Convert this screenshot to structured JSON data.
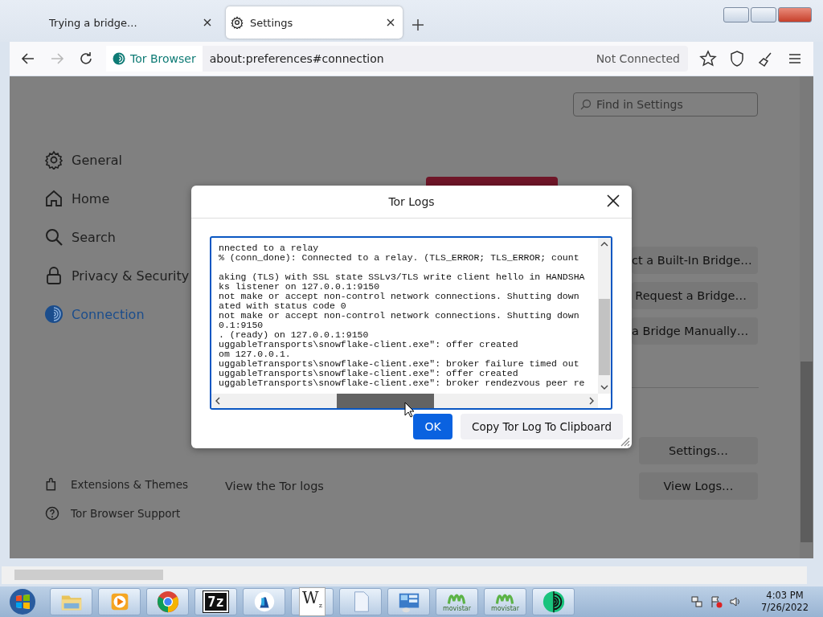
{
  "tabs": [
    {
      "title": "Trying a bridge...",
      "selected": false
    },
    {
      "title": "Settings",
      "selected": true
    }
  ],
  "toolbar": {
    "identity": "Tor Browser",
    "url": "about:preferences#connection",
    "status": "Not Connected",
    "forward_disabled": true
  },
  "search": {
    "placeholder": "Find in Settings"
  },
  "sidebar": {
    "items": [
      {
        "label": "General",
        "kind": "gear",
        "selected": false
      },
      {
        "label": "Home",
        "kind": "home",
        "selected": false
      },
      {
        "label": "Search",
        "kind": "search",
        "selected": false
      },
      {
        "label": "Privacy & Security",
        "kind": "lock",
        "selected": false
      },
      {
        "label": "Connection",
        "kind": "onion",
        "selected": true
      }
    ],
    "footer": [
      {
        "label": "Extensions & Themes",
        "kind": "puzzle"
      },
      {
        "label": "Tor Browser Support",
        "kind": "help"
      }
    ]
  },
  "bridges": {
    "buttons": [
      "ct a Built-In Bridge…",
      "Request a Bridge…",
      "a Bridge Manually…"
    ]
  },
  "advanced": {
    "settings_button": "Settings…",
    "logs_label": "View the Tor logs",
    "logs_button": "View Logs…"
  },
  "dialog": {
    "title": "Tor Logs",
    "log_blocks": [
      [
        "nnected to a relay",
        "% (conn_done): Connected to a relay. (TLS_ERROR; TLS_ERROR; count"
      ],
      [
        "aking (TLS) with SSL state SSLv3/TLS write client hello in HANDSHA",
        "ks listener on 127.0.0.1:9150",
        "not make or accept non-control network connections. Shutting down",
        "ated with status code 0",
        "not make or accept non-control network connections. Shutting down",
        "0.1:9150",
        ". (ready) on 127.0.0.1:9150",
        "uggableTransports\\snowflake-client.exe\": offer created",
        "om 127.0.0.1.",
        "uggableTransports\\snowflake-client.exe\": broker failure timed out",
        "uggableTransports\\snowflake-client.exe\": offer created",
        "uggableTransports\\snowflake-client.exe\": broker rendezvous peer re"
      ]
    ],
    "ok_button": "OK",
    "copy_button": "Copy Tor Log To Clipboard"
  },
  "taskbar": {
    "items": [
      {
        "kind": "folder"
      },
      {
        "kind": "media"
      },
      {
        "kind": "chrome"
      },
      {
        "kind": "archive",
        "label": "7z"
      },
      {
        "kind": "app"
      },
      {
        "kind": "doc-w",
        "label": "W",
        "sub": "z"
      },
      {
        "kind": "page"
      },
      {
        "kind": "panel"
      },
      {
        "kind": "movistar",
        "label": "movistar"
      },
      {
        "kind": "movistar",
        "label": "movistar"
      },
      {
        "kind": "tor"
      }
    ],
    "clock": {
      "time": "4:03 PM",
      "date": "7/26/2022"
    }
  }
}
